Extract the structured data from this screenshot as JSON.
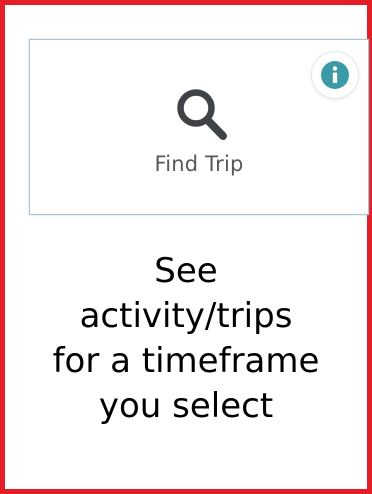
{
  "tile": {
    "label": "Find Trip",
    "icon": "search-icon",
    "info_icon": "info-icon",
    "accent_color": "#3a9aa5"
  },
  "caption": {
    "lines": [
      "See",
      "activity/trips",
      "for a timeframe",
      "you select"
    ]
  },
  "colors": {
    "frame_border": "#e41e26",
    "card_border": "#a9c4d2",
    "icon_dark": "#3f4347"
  }
}
